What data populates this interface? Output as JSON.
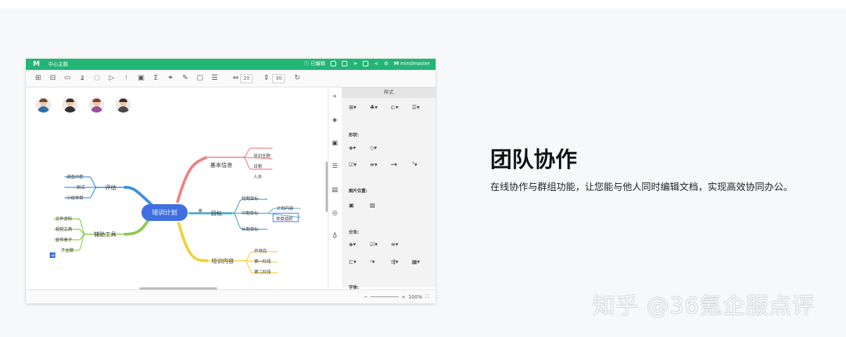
{
  "app": {
    "doc_title": "中心主题",
    "logo_mark": "M",
    "help_label": "已编辑",
    "brand": "mindmaster",
    "toolbar": {
      "num1": "20",
      "num2": "30"
    },
    "panel": {
      "title": "样式",
      "sections": [
        "形状:",
        "图片位置:",
        "分支:",
        "字体:"
      ]
    },
    "status": {
      "zoom": "100%"
    },
    "colors": {
      "accent": "#23b574",
      "central": "#3f6fe0"
    }
  },
  "mindmap": {
    "central": "培训计划",
    "branches": {
      "basic": {
        "label": "基本信息",
        "children": [
          "培训主题",
          "日期",
          "人员"
        ]
      },
      "eval": {
        "label": "评估",
        "children": [
          "调查问卷",
          "测试",
          "小组项目"
        ]
      },
      "tools": {
        "label": "辅助工具",
        "children": [
          "文件资料",
          "视觉工具",
          "宣传册子",
          "子主题"
        ]
      },
      "goal": {
        "label": "目标",
        "children": [
          "短期目标",
          "中期目标",
          "长期目标"
        ],
        "sub": [
          "计划内容",
          "项目组织"
        ]
      },
      "content": {
        "label": "培训内容",
        "children": [
          "开场白",
          "第一阶段",
          "第二阶段"
        ]
      }
    }
  },
  "feature": {
    "heading": "团队协作",
    "description": "在线协作与群组功能，让您能与他人同时编辑文档，实现高效协同办公。"
  },
  "watermark": "知乎 @36氪企服点评"
}
